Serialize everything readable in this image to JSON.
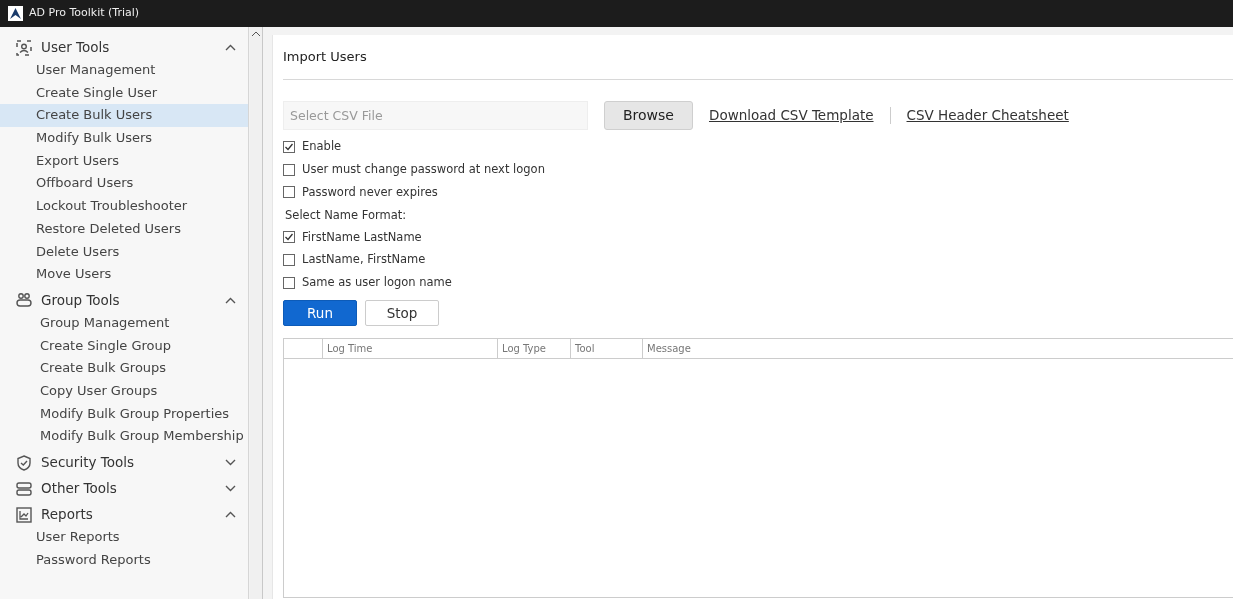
{
  "window": {
    "title": "AD Pro Toolkit (Trial)"
  },
  "sidebar": {
    "sections": [
      {
        "label": "User Tools",
        "expanded": true,
        "items": [
          {
            "label": "User Management",
            "selected": false
          },
          {
            "label": "Create Single User",
            "selected": false
          },
          {
            "label": "Create Bulk Users",
            "selected": true
          },
          {
            "label": "Modify Bulk Users",
            "selected": false
          },
          {
            "label": "Export Users",
            "selected": false
          },
          {
            "label": "Offboard Users",
            "selected": false
          },
          {
            "label": "Lockout Troubleshooter",
            "selected": false
          },
          {
            "label": "Restore Deleted Users",
            "selected": false
          },
          {
            "label": "Delete Users",
            "selected": false
          },
          {
            "label": "Move Users",
            "selected": false
          }
        ]
      },
      {
        "label": "Group Tools",
        "expanded": true,
        "items": [
          {
            "label": "Group Management",
            "selected": false
          },
          {
            "label": "Create Single Group",
            "selected": false
          },
          {
            "label": "Create Bulk Groups",
            "selected": false
          },
          {
            "label": "Copy User Groups",
            "selected": false
          },
          {
            "label": "Modify Bulk Group Properties",
            "selected": false
          },
          {
            "label": "Modify Bulk Group Membership",
            "selected": false
          }
        ]
      },
      {
        "label": "Security Tools",
        "expanded": false
      },
      {
        "label": "Other Tools",
        "expanded": false
      },
      {
        "label": "Reports",
        "expanded": true,
        "items": [
          {
            "label": "User Reports",
            "selected": false
          },
          {
            "label": "Password Reports",
            "selected": false
          }
        ]
      }
    ]
  },
  "panel": {
    "title": "Import Users",
    "file_field": {
      "placeholder": "Select CSV File"
    },
    "browse_button": "Browse",
    "links": [
      "Download CSV Template",
      "CSV Header Cheatsheet"
    ],
    "options": [
      {
        "label": "Enable",
        "checked": true
      },
      {
        "label": "User must change password at next logon",
        "checked": false
      },
      {
        "label": "Password never expires",
        "checked": false
      }
    ],
    "name_format_label": "Select Name Format:",
    "name_formats": [
      {
        "label": "FirstName LastName",
        "checked": true
      },
      {
        "label": "LastName, FirstName",
        "checked": false
      },
      {
        "label": "Same as user logon name",
        "checked": false
      }
    ],
    "buttons": [
      {
        "label": "Run",
        "kind": "primary"
      },
      {
        "label": "Stop",
        "kind": "secondary"
      }
    ],
    "table": {
      "columns": [
        "Log Time",
        "Log Type",
        "Tool",
        "Message"
      ]
    }
  }
}
